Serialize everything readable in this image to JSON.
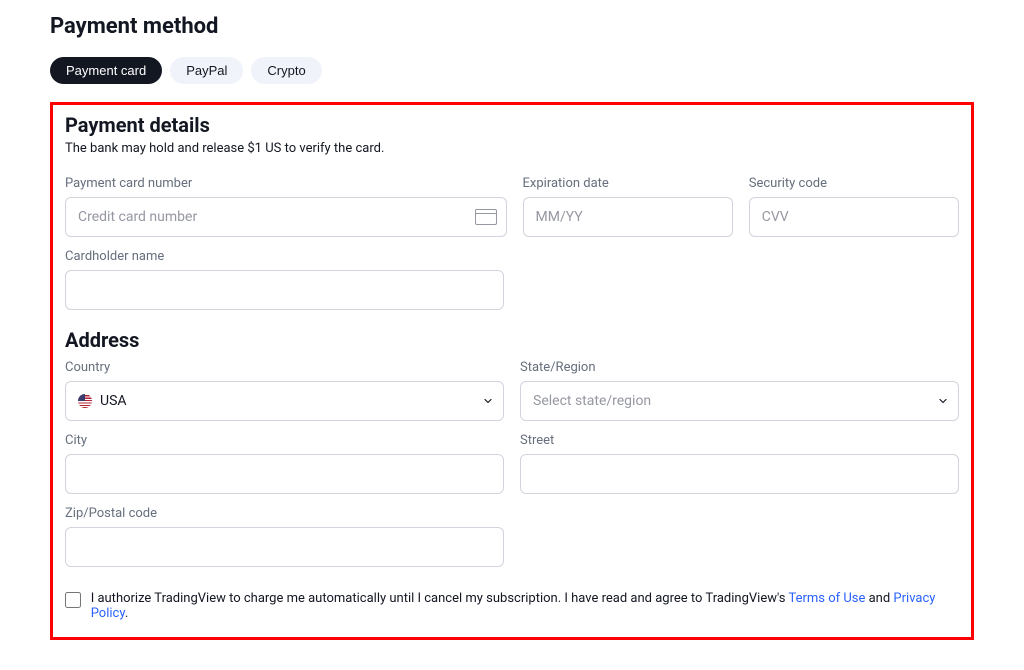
{
  "page_title": "Payment method",
  "tabs": {
    "card": "Payment card",
    "paypal": "PayPal",
    "crypto": "Crypto"
  },
  "details": {
    "title": "Payment details",
    "note": "The bank may hold and release $1 US to verify the card.",
    "card_number_label": "Payment card number",
    "card_number_placeholder": "Credit card number",
    "exp_label": "Expiration date",
    "exp_placeholder": "MM/YY",
    "cvv_label": "Security code",
    "cvv_placeholder": "CVV",
    "holder_label": "Cardholder name"
  },
  "address": {
    "title": "Address",
    "country_label": "Country",
    "country_value": "USA",
    "state_label": "State/Region",
    "state_placeholder": "Select state/region",
    "city_label": "City",
    "street_label": "Street",
    "zip_label": "Zip/Postal code"
  },
  "consent": {
    "text_pre": "I authorize TradingView to charge me automatically until I cancel my subscription. I have read and agree to TradingView's ",
    "terms": "Terms of Use",
    "mid": " and ",
    "privacy": "Privacy Policy",
    "tail": "."
  }
}
